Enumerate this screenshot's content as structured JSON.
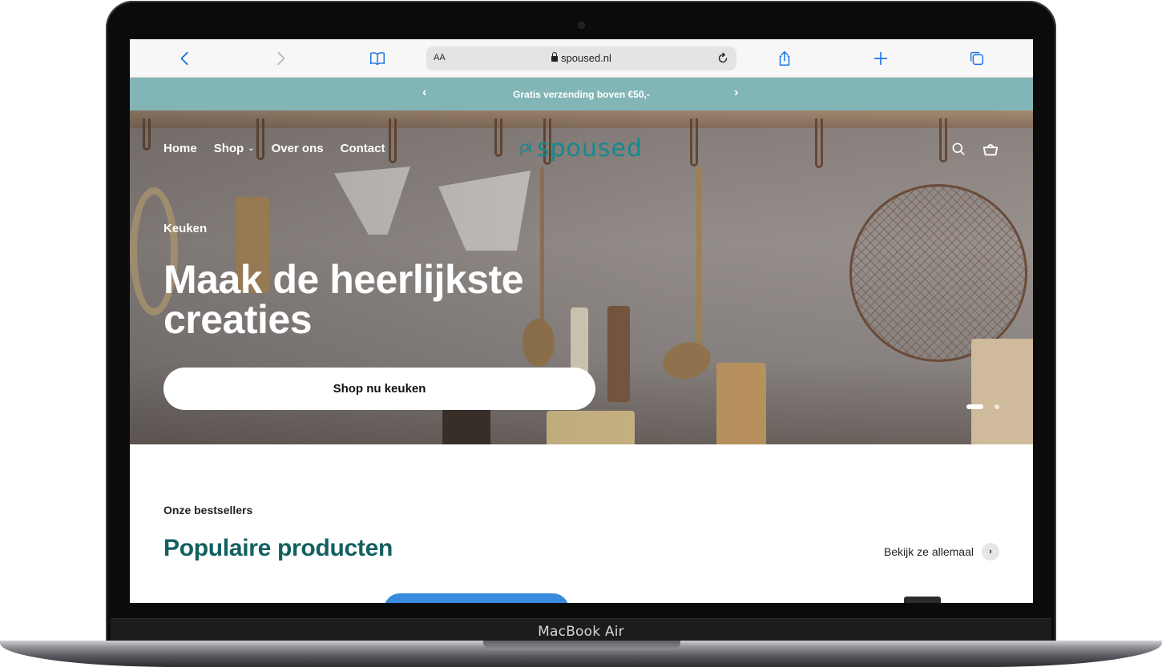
{
  "device": {
    "brand_label": "MacBook Air"
  },
  "browser": {
    "address_bar": {
      "aa_label": "AA",
      "url": "spoused.nl"
    },
    "icons": [
      "back-icon",
      "forward-icon",
      "bookmarks-icon",
      "lock-icon",
      "reload-icon",
      "share-icon",
      "new-tab-icon",
      "tabs-icon"
    ]
  },
  "announcement": {
    "text": "Gratis verzending boven €50,-",
    "prev": "‹",
    "next": "›"
  },
  "header": {
    "nav": [
      {
        "label": "Home"
      },
      {
        "label": "Shop",
        "chevron": "⌄"
      },
      {
        "label": "Over ons"
      },
      {
        "label": "Contact"
      }
    ],
    "logo_text": "spoused",
    "icons": [
      "search-icon",
      "basket-icon"
    ]
  },
  "hero": {
    "eyebrow": "Keuken",
    "headline": "Maak de heerlijkste creaties",
    "cta": "Shop nu keuken",
    "slides": {
      "count": 2,
      "active": 1
    }
  },
  "bestsellers": {
    "eyebrow": "Onze bestsellers",
    "title": "Populaire producten",
    "see_all": "Bekijk ze allemaal",
    "see_all_arrow": "›"
  },
  "colors": {
    "announcement_bg": "#82b5b6",
    "brand_teal": "#12605f",
    "logo_teal": "#138a8f",
    "browser_accent": "#1a73e8"
  }
}
